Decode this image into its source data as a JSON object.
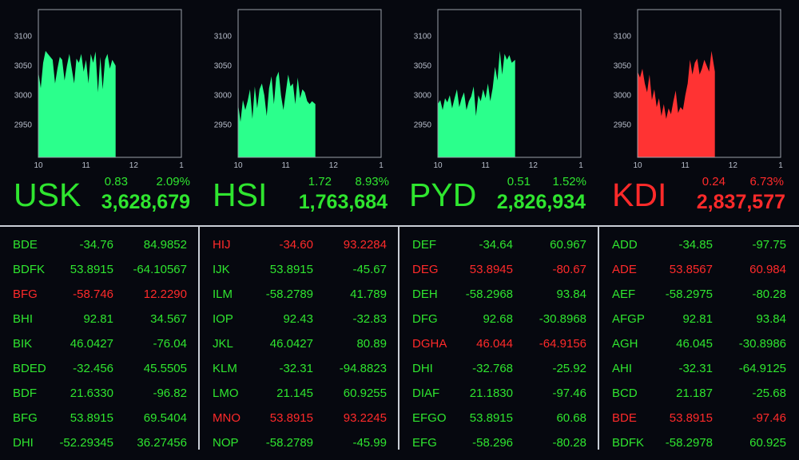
{
  "colors": {
    "up": "#2fe52f",
    "down": "#ff2a2a",
    "fill_up": "#2bff8c",
    "fill_down": "#ff3333",
    "frame": "#9aa0aa"
  },
  "chart_data": [
    {
      "type": "area",
      "title": "",
      "xlim": [
        10,
        13
      ],
      "ylim": [
        2895,
        3145
      ],
      "x_ticks": [
        "10",
        "11",
        "12",
        "1"
      ],
      "y_ticks": [
        3100,
        3050,
        3000,
        2950
      ],
      "x": [
        10,
        10.05,
        10.1,
        10.15,
        10.2,
        10.3,
        10.35,
        10.4,
        10.45,
        10.5,
        10.55,
        10.6,
        10.65,
        10.7,
        10.75,
        10.8,
        10.85,
        10.9,
        10.95,
        11,
        11.05,
        11.1,
        11.15,
        11.2,
        11.25,
        11.3,
        11.35,
        11.4,
        11.45,
        11.5,
        11.55,
        11.62
      ],
      "series": [
        {
          "color": "#2bff8c",
          "values": [
            3040,
            3012,
            3055,
            3075,
            3070,
            3060,
            3020,
            3045,
            3065,
            3060,
            3025,
            3050,
            3070,
            3045,
            3020,
            3062,
            3055,
            3070,
            3040,
            3060,
            3020,
            3070,
            3055,
            3074,
            3005,
            3065,
            3010,
            3060,
            3070,
            3045,
            3060,
            3050
          ]
        }
      ],
      "header": {
        "change": "0.83",
        "pct": "2.09%",
        "symbol": "USK",
        "total": "3,628,679",
        "trend": "up"
      }
    },
    {
      "type": "area",
      "title": "",
      "xlim": [
        10,
        13
      ],
      "ylim": [
        2895,
        3145
      ],
      "x_ticks": [
        "10",
        "11",
        "12",
        "1"
      ],
      "y_ticks": [
        3100,
        3050,
        3000,
        2950
      ],
      "x": [
        10,
        10.05,
        10.1,
        10.15,
        10.2,
        10.25,
        10.3,
        10.35,
        10.4,
        10.45,
        10.5,
        10.55,
        10.6,
        10.65,
        10.7,
        10.75,
        10.8,
        10.85,
        10.9,
        10.95,
        11,
        11.05,
        11.1,
        11.15,
        11.2,
        11.25,
        11.3,
        11.35,
        11.4,
        11.45,
        11.5,
        11.55,
        11.62
      ],
      "series": [
        {
          "color": "#2bff8c",
          "values": [
            2985,
            2955,
            2992,
            2975,
            2990,
            3010,
            2960,
            3015,
            2978,
            3010,
            3020,
            3000,
            2965,
            3012,
            3032,
            2985,
            3030,
            3040,
            3000,
            2975,
            3005,
            3035,
            3015,
            3020,
            2985,
            3030,
            2995,
            3010,
            3005,
            2990,
            2985,
            2990,
            2985
          ]
        }
      ],
      "header": {
        "change": "1.72",
        "pct": "8.93%",
        "symbol": "HSI",
        "total": "1,763,684",
        "trend": "up"
      }
    },
    {
      "type": "area",
      "title": "",
      "xlim": [
        10,
        13
      ],
      "ylim": [
        2895,
        3145
      ],
      "x_ticks": [
        "10",
        "11",
        "12",
        "1"
      ],
      "y_ticks": [
        3100,
        3050,
        3000,
        2950
      ],
      "x": [
        10,
        10.05,
        10.1,
        10.15,
        10.2,
        10.25,
        10.3,
        10.35,
        10.4,
        10.45,
        10.5,
        10.55,
        10.6,
        10.65,
        10.7,
        10.75,
        10.8,
        10.85,
        10.9,
        10.95,
        11,
        11.05,
        11.1,
        11.15,
        11.2,
        11.25,
        11.3,
        11.35,
        11.4,
        11.45,
        11.5,
        11.55,
        11.62
      ],
      "series": [
        {
          "color": "#2bff8c",
          "values": [
            2985,
            2992,
            2975,
            2995,
            2988,
            3000,
            2978,
            2995,
            3010,
            2980,
            2995,
            3005,
            2975,
            2990,
            2998,
            3015,
            2965,
            3000,
            2990,
            3010,
            2995,
            3020,
            2990,
            3012,
            3048,
            3025,
            3075,
            3035,
            3070,
            3060,
            3068,
            3055,
            3060
          ]
        }
      ],
      "header": {
        "change": "0.51",
        "pct": "1.52%",
        "symbol": "PYD",
        "total": "2,826,934",
        "trend": "up"
      }
    },
    {
      "type": "area",
      "title": "",
      "xlim": [
        10,
        13
      ],
      "ylim": [
        2895,
        3145
      ],
      "x_ticks": [
        "10",
        "11",
        "12",
        "1"
      ],
      "y_ticks": [
        3100,
        3050,
        3000,
        2950
      ],
      "x": [
        10,
        10.05,
        10.1,
        10.15,
        10.2,
        10.25,
        10.3,
        10.35,
        10.4,
        10.45,
        10.5,
        10.55,
        10.6,
        10.65,
        10.7,
        10.75,
        10.8,
        10.85,
        10.9,
        10.95,
        11,
        11.05,
        11.1,
        11.15,
        11.2,
        11.25,
        11.3,
        11.35,
        11.4,
        11.45,
        11.5,
        11.55,
        11.62
      ],
      "series": [
        {
          "color": "#ff3333",
          "values": [
            3040,
            3030,
            3045,
            3020,
            3005,
            3035,
            2992,
            3010,
            2980,
            2995,
            2965,
            2985,
            2960,
            2978,
            2968,
            2990,
            3008,
            2970,
            2980,
            2975,
            3000,
            3020,
            3060,
            3035,
            3055,
            3062,
            3035,
            3045,
            3060,
            3050,
            3040,
            3075,
            3040
          ]
        }
      ],
      "header": {
        "change": "0.24",
        "pct": "6.73%",
        "symbol": "KDI",
        "total": "2,837,577",
        "trend": "down"
      }
    }
  ],
  "tables": [
    [
      {
        "sym": "BDE",
        "v1": "-34.76",
        "v2": "84.9852",
        "t": "up"
      },
      {
        "sym": "BDFK",
        "v1": "53.8915",
        "v2": "-64.10567",
        "t": "up"
      },
      {
        "sym": "BFG",
        "v1": "-58.746",
        "v2": "12.2290",
        "t": "down"
      },
      {
        "sym": "BHI",
        "v1": "92.81",
        "v2": "34.567",
        "t": "up"
      },
      {
        "sym": "BIK",
        "v1": "46.0427",
        "v2": "-76.04",
        "t": "up"
      },
      {
        "sym": "BDED",
        "v1": "-32.456",
        "v2": "45.5505",
        "t": "up"
      },
      {
        "sym": "BDF",
        "v1": "21.6330",
        "v2": "-96.82",
        "t": "up"
      },
      {
        "sym": "BFG",
        "v1": "53.8915",
        "v2": "69.5404",
        "t": "up"
      },
      {
        "sym": "DHI",
        "v1": "-52.29345",
        "v2": "36.27456",
        "t": "up"
      }
    ],
    [
      {
        "sym": "HIJ",
        "v1": "-34.60",
        "v2": "93.2284",
        "t": "down"
      },
      {
        "sym": "IJK",
        "v1": "53.8915",
        "v2": "-45.67",
        "t": "up"
      },
      {
        "sym": "ILM",
        "v1": "-58.2789",
        "v2": "41.789",
        "t": "up"
      },
      {
        "sym": "IOP",
        "v1": "92.43",
        "v2": "-32.83",
        "t": "up"
      },
      {
        "sym": "JKL",
        "v1": "46.0427",
        "v2": "80.89",
        "t": "up"
      },
      {
        "sym": "KLM",
        "v1": "-32.31",
        "v2": "-94.8823",
        "t": "up"
      },
      {
        "sym": "LMO",
        "v1": "21.145",
        "v2": "60.9255",
        "t": "up"
      },
      {
        "sym": "MNO",
        "v1": "53.8915",
        "v2": "93.2245",
        "t": "down"
      },
      {
        "sym": "NOP",
        "v1": "-58.2789",
        "v2": "-45.99",
        "t": "up"
      }
    ],
    [
      {
        "sym": "DEF",
        "v1": "-34.64",
        "v2": "60.967",
        "t": "up"
      },
      {
        "sym": "DEG",
        "v1": "53.8945",
        "v2": "-80.67",
        "t": "down"
      },
      {
        "sym": "DEH",
        "v1": "-58.2968",
        "v2": "93.84",
        "t": "up"
      },
      {
        "sym": "DFG",
        "v1": "92.68",
        "v2": "-30.8968",
        "t": "up"
      },
      {
        "sym": "DGHA",
        "v1": "46.044",
        "v2": "-64.9156",
        "t": "down"
      },
      {
        "sym": "DHI",
        "v1": "-32.768",
        "v2": "-25.92",
        "t": "up"
      },
      {
        "sym": "DIAF",
        "v1": "21.1830",
        "v2": "-97.46",
        "t": "up"
      },
      {
        "sym": "EFGO",
        "v1": "53.8915",
        "v2": "60.68",
        "t": "up"
      },
      {
        "sym": "EFG",
        "v1": "-58.296",
        "v2": "-80.28",
        "t": "up"
      }
    ],
    [
      {
        "sym": "ADD",
        "v1": "-34.85",
        "v2": "-97.75",
        "t": "up"
      },
      {
        "sym": "ADE",
        "v1": "53.8567",
        "v2": "60.984",
        "t": "down"
      },
      {
        "sym": "AEF",
        "v1": "-58.2975",
        "v2": "-80.28",
        "t": "up"
      },
      {
        "sym": "AFGP",
        "v1": "92.81",
        "v2": "93.84",
        "t": "up"
      },
      {
        "sym": "AGH",
        "v1": "46.045",
        "v2": "-30.8986",
        "t": "up"
      },
      {
        "sym": "AHI",
        "v1": "-32.31",
        "v2": "-64.9125",
        "t": "up"
      },
      {
        "sym": "BCD",
        "v1": "21.187",
        "v2": "-25.68",
        "t": "up"
      },
      {
        "sym": "BDE",
        "v1": "53.8915",
        "v2": "-97.46",
        "t": "down"
      },
      {
        "sym": "BDFK",
        "v1": "-58.2978",
        "v2": "60.925",
        "t": "up"
      }
    ]
  ]
}
